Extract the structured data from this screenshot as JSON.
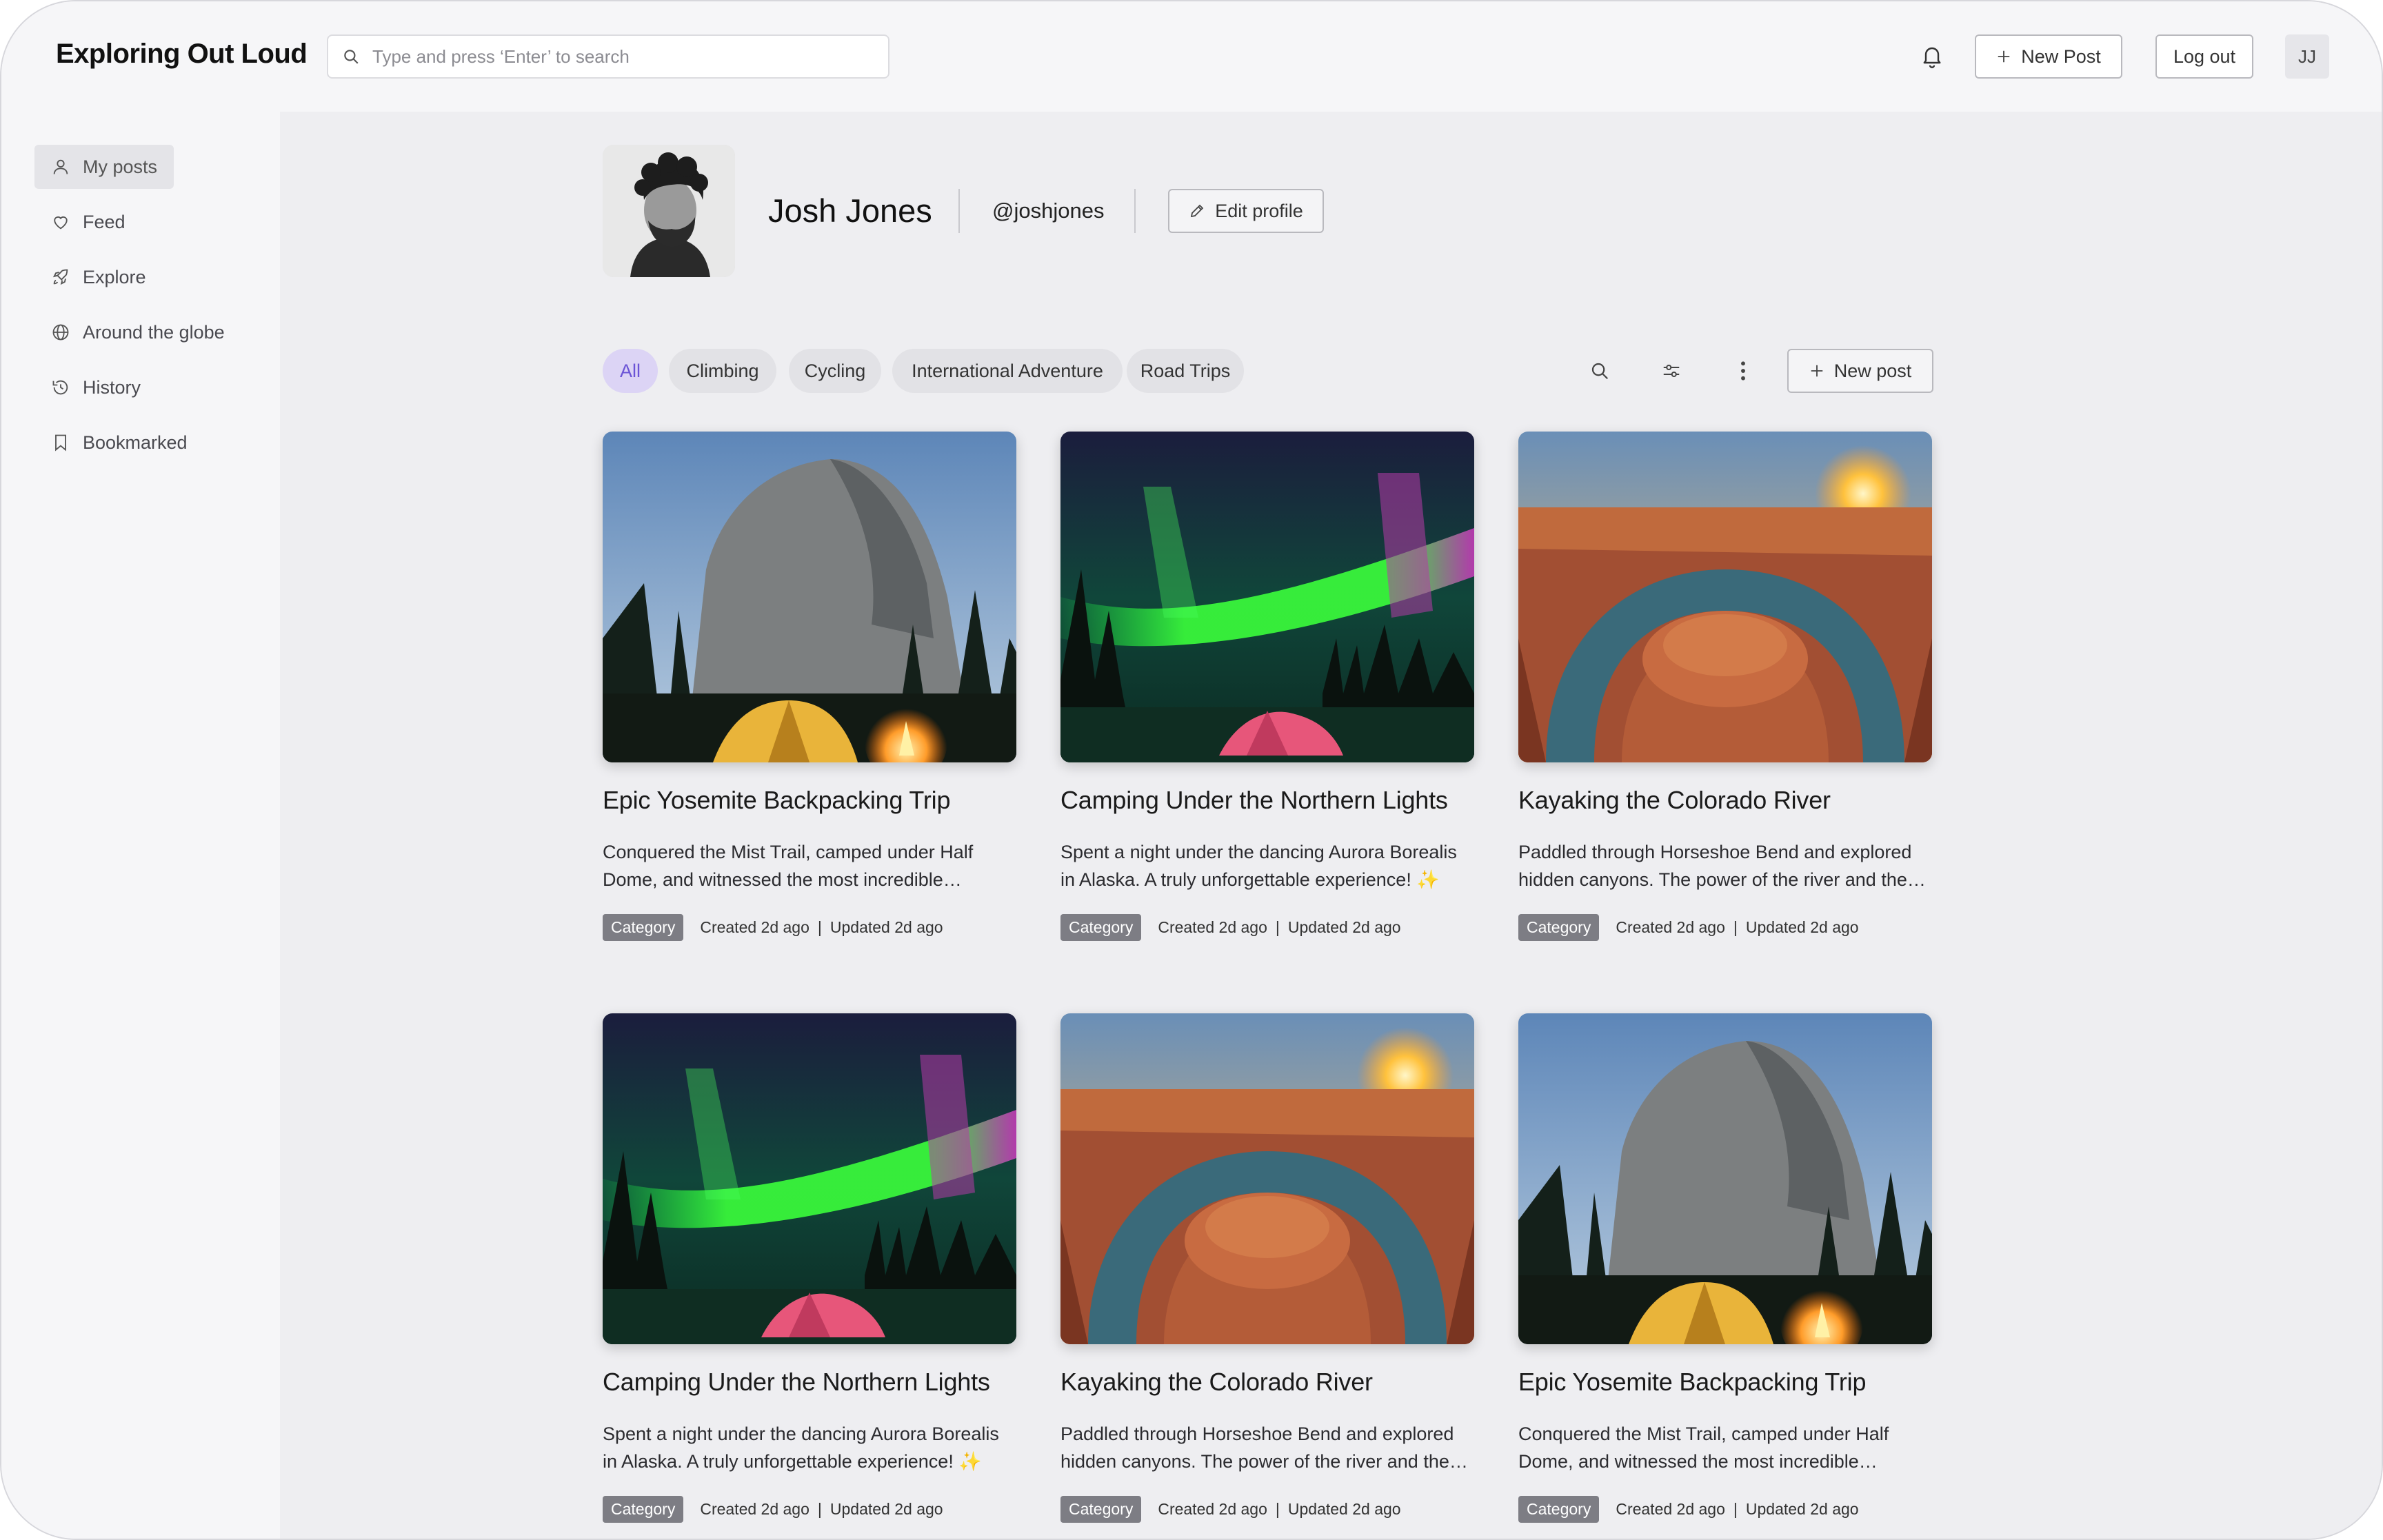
{
  "app": {
    "title": "Exploring Out Loud"
  },
  "search": {
    "placeholder": "Type and press ‘Enter’ to search"
  },
  "header": {
    "new_post_label": "New Post",
    "logout_label": "Log out",
    "user_initials": "JJ"
  },
  "sidebar": {
    "items": [
      {
        "label": "My posts",
        "icon": "user-icon",
        "active": true
      },
      {
        "label": "Feed",
        "icon": "heart-icon"
      },
      {
        "label": "Explore",
        "icon": "rocket-icon"
      },
      {
        "label": "Around the globe",
        "icon": "globe-icon"
      },
      {
        "label": "History",
        "icon": "history-icon"
      },
      {
        "label": "Bookmarked",
        "icon": "bookmark-icon"
      }
    ]
  },
  "profile": {
    "name": "Josh Jones",
    "handle": "@joshjones",
    "edit_label": "Edit profile"
  },
  "filters": {
    "chips": [
      "All",
      "Climbing",
      "Cycling",
      "International Adventure",
      "Road Trips"
    ],
    "active": "All",
    "new_post_label": "New post"
  },
  "posts": [
    {
      "title": "Epic Yosemite Backpacking Trip",
      "description": "Conquered the Mist Trail, camped under Half Dome, and witnessed the most incredible sunsets...",
      "category": "Category",
      "created": "Created 2d ago",
      "separator": "|",
      "updated": "Updated 2d ago",
      "image": "yosemite"
    },
    {
      "title": "Camping Under the Northern Lights",
      "description": "Spent a night under the dancing Aurora Borealis in Alaska. A truly unforgettable experience! ✨",
      "category": "Category",
      "created": "Created 2d ago",
      "separator": "|",
      "updated": "Updated 2d ago",
      "image": "aurora"
    },
    {
      "title": "Kayaking the Colorado River",
      "description": "Paddled through Horseshoe Bend and explored hidden canyons. The power of the river and the be...",
      "category": "Category",
      "created": "Created 2d ago",
      "separator": "|",
      "updated": "Updated 2d ago",
      "image": "canyon"
    },
    {
      "title": "Camping Under the Northern Lights",
      "description": "Spent a night under the dancing Aurora Borealis in Alaska. A truly unforgettable experience! ✨",
      "category": "Category",
      "created": "Created 2d ago",
      "separator": "|",
      "updated": "Updated 2d ago",
      "image": "aurora"
    },
    {
      "title": "Kayaking the Colorado River",
      "description": "Paddled through Horseshoe Bend and explored hidden canyons. The power of the river and the be...",
      "category": "Category",
      "created": "Created 2d ago",
      "separator": "|",
      "updated": "Updated 2d ago",
      "image": "canyon"
    },
    {
      "title": "Epic Yosemite Backpacking Trip",
      "description": "Conquered the Mist Trail, camped under Half Dome, and witnessed the most incredible sunsets...",
      "category": "Category",
      "created": "Created 2d ago",
      "separator": "|",
      "updated": "Updated 2d ago",
      "image": "yosemite"
    }
  ],
  "colors": {
    "accent": "#6b54d6",
    "accent_bg": "#dcd4f5",
    "badge": "#7d7d84"
  }
}
